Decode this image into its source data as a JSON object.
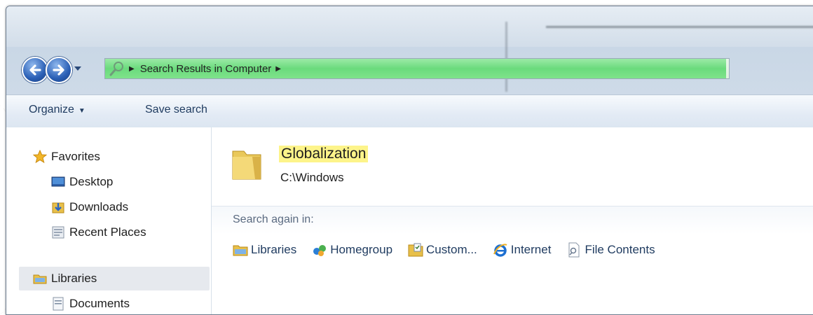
{
  "navigation": {
    "back_label": "Back",
    "forward_label": "Forward"
  },
  "address_bar": {
    "icon": "search-magnifier-icon",
    "crumbs": [
      "Search Results in Computer"
    ],
    "highlight_color": "#55d66a"
  },
  "toolbar": {
    "organize_label": "Organize",
    "save_search_label": "Save search"
  },
  "nav_pane": {
    "favorites": {
      "label": "Favorites",
      "icon": "star-icon",
      "items": [
        {
          "label": "Desktop",
          "icon": "desktop-icon"
        },
        {
          "label": "Downloads",
          "icon": "downloads-icon"
        },
        {
          "label": "Recent Places",
          "icon": "recent-places-icon"
        }
      ]
    },
    "libraries": {
      "label": "Libraries",
      "icon": "libraries-icon",
      "items": [
        {
          "label": "Documents",
          "icon": "documents-icon"
        }
      ]
    }
  },
  "results": [
    {
      "name": "Globalization",
      "path": "C:\\Windows",
      "icon": "folder-icon",
      "highlight_color": "#fdf48a"
    }
  ],
  "search_again": {
    "label": "Search again in:",
    "locations": [
      {
        "label": "Libraries",
        "icon": "libraries-icon"
      },
      {
        "label": "Homegroup",
        "icon": "homegroup-icon"
      },
      {
        "label": "Custom...",
        "icon": "custom-folder-icon"
      },
      {
        "label": "Internet",
        "icon": "internet-explorer-icon"
      },
      {
        "label": "File Contents",
        "icon": "file-contents-icon"
      }
    ]
  }
}
